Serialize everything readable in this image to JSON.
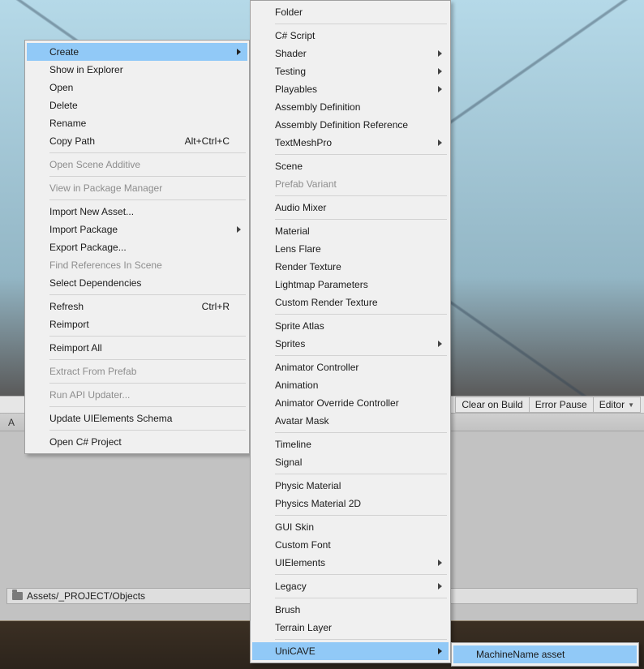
{
  "toolbar": {
    "clear_on_build": "Clear on Build",
    "error_pause": "Error Pause",
    "editor": "Editor"
  },
  "tabstrip": {
    "label": "A"
  },
  "breadcrumb": {
    "path": "Assets/_PROJECT/Objects"
  },
  "menu1": {
    "create": "Create",
    "show_in_explorer": "Show in Explorer",
    "open": "Open",
    "delete": "Delete",
    "rename": "Rename",
    "copy_path": "Copy Path",
    "copy_path_sc": "Alt+Ctrl+C",
    "open_scene_additive": "Open Scene Additive",
    "view_in_package_manager": "View in Package Manager",
    "import_new_asset": "Import New Asset...",
    "import_package": "Import Package",
    "export_package": "Export Package...",
    "find_references": "Find References In Scene",
    "select_dependencies": "Select Dependencies",
    "refresh": "Refresh",
    "refresh_sc": "Ctrl+R",
    "reimport": "Reimport",
    "reimport_all": "Reimport All",
    "extract_from_prefab": "Extract From Prefab",
    "run_api_updater": "Run API Updater...",
    "update_uielements": "Update UIElements Schema",
    "open_csharp": "Open C# Project"
  },
  "menu2": {
    "folder": "Folder",
    "csharp": "C# Script",
    "shader": "Shader",
    "testing": "Testing",
    "playables": "Playables",
    "assembly_def": "Assembly Definition",
    "assembly_def_ref": "Assembly Definition Reference",
    "textmeshpro": "TextMeshPro",
    "scene": "Scene",
    "prefab_variant": "Prefab Variant",
    "audio_mixer": "Audio Mixer",
    "material": "Material",
    "lens_flare": "Lens Flare",
    "render_texture": "Render Texture",
    "lightmap_params": "Lightmap Parameters",
    "custom_render_texture": "Custom Render Texture",
    "sprite_atlas": "Sprite Atlas",
    "sprites": "Sprites",
    "animator_controller": "Animator Controller",
    "animation": "Animation",
    "animator_override": "Animator Override Controller",
    "avatar_mask": "Avatar Mask",
    "timeline": "Timeline",
    "signal": "Signal",
    "physic_material": "Physic Material",
    "physics_material_2d": "Physics Material 2D",
    "gui_skin": "GUI Skin",
    "custom_font": "Custom Font",
    "uielements": "UIElements",
    "legacy": "Legacy",
    "brush": "Brush",
    "terrain_layer": "Terrain Layer",
    "unicave": "UniCAVE"
  },
  "menu3": {
    "machine_name_asset": "MachineName asset"
  }
}
